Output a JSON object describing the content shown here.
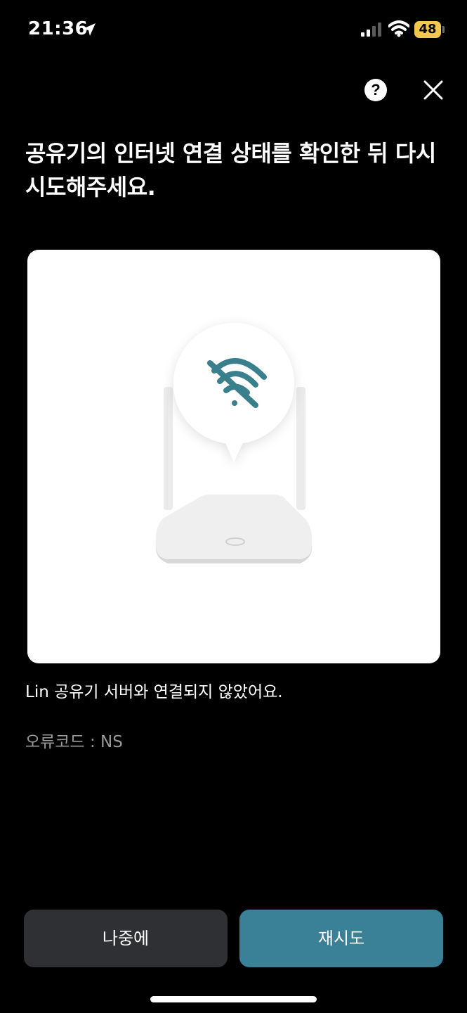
{
  "status_bar": {
    "time": "21:36",
    "battery": "48",
    "icons": [
      "location-arrow-icon",
      "cellular-signal-icon",
      "wifi-icon",
      "battery-icon"
    ]
  },
  "header": {
    "help_label": "?",
    "icons": [
      "help-icon",
      "close-icon"
    ]
  },
  "headline": "공유기의 인터넷 연결 상태를 확인한 뒤 다시 시도해주세요.",
  "illustration": {
    "icons": [
      "router-icon",
      "wifi-off-icon"
    ],
    "accent_color": "#3a7f8c"
  },
  "message": "Lin 공유기 서버와 연결되지 않았어요.",
  "error_code": "오류코드 : NS",
  "buttons": {
    "later": "나중에",
    "retry": "재시도"
  },
  "colors": {
    "background": "#000000",
    "retry_button": "#3a8096",
    "later_button": "#2f3033",
    "battery": "#f2c94c"
  }
}
